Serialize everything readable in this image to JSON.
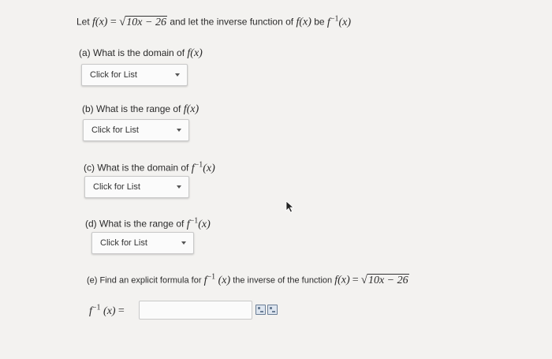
{
  "intro": {
    "let": "Let",
    "and_let": "and let the inverse function of",
    "be": "be"
  },
  "math": {
    "f": "f",
    "x": "(x)",
    "equals": "=",
    "radicand": "10x − 26",
    "inv_exp": "−1"
  },
  "questions": [
    {
      "prefix": "(a) What is the domain of",
      "dropdown": "Click for List"
    },
    {
      "prefix": "(b) What is the range of",
      "dropdown": "Click for List"
    },
    {
      "prefix": "(c) What is the domain of",
      "dropdown": "Click for List"
    },
    {
      "prefix": "(d) What is the range of",
      "dropdown": "Click for List"
    }
  ],
  "part_e": {
    "prefix": "(e) Find an explicit formula for",
    "middle": "the inverse of the function",
    "answer_value": ""
  },
  "icons": [
    "equation-editor-icon",
    "preview-icon"
  ]
}
